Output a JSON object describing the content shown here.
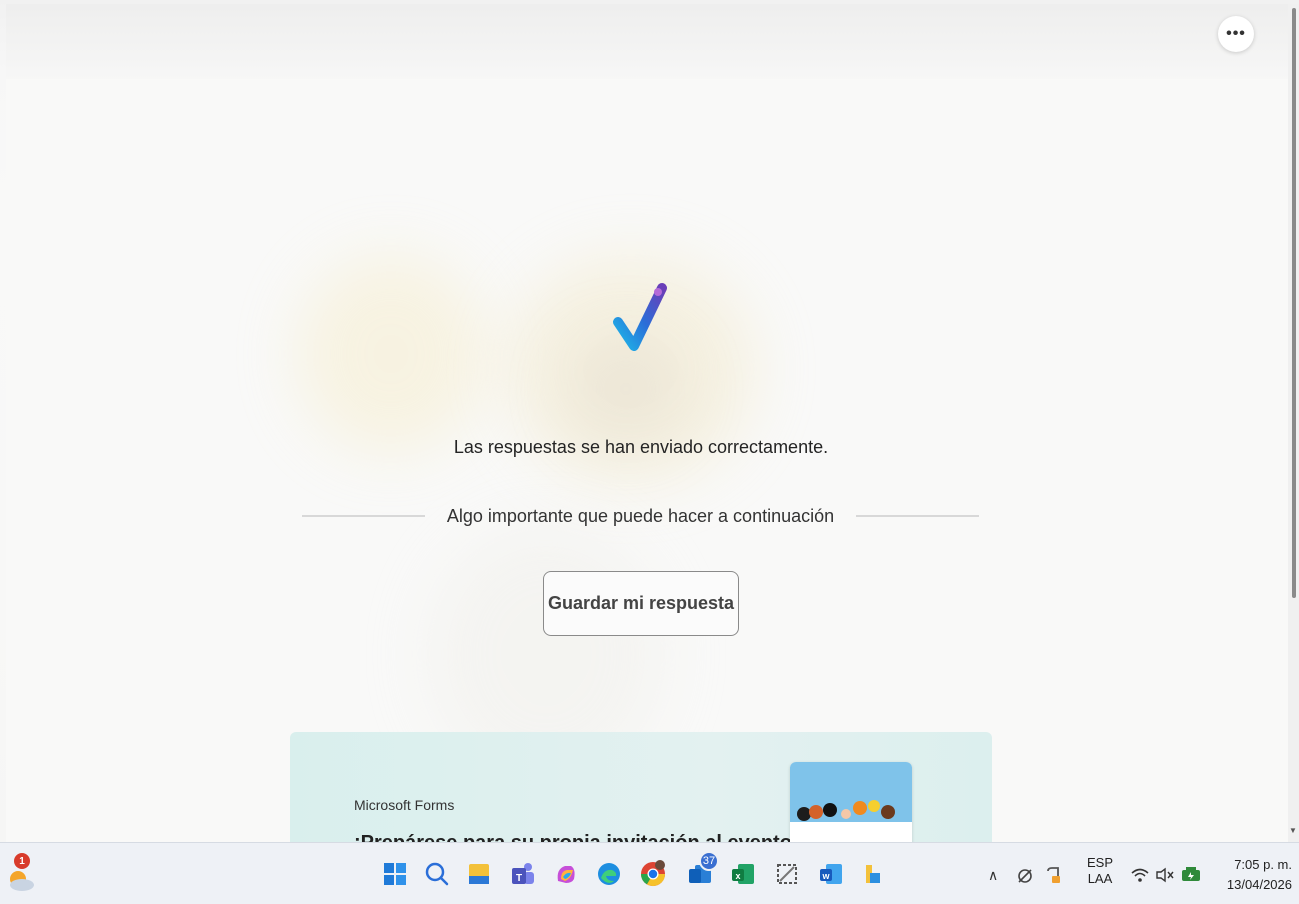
{
  "page": {
    "more_label": "•••",
    "confirmation": "Las respuestas se han enviado correctamente.",
    "next_step": "Algo importante que puede hacer a continuación",
    "save_button": "Guardar mi respuesta",
    "promo": {
      "brand": "Microsoft Forms",
      "title": "¡Prepárese para su propia invitación al evento!"
    }
  },
  "taskbar": {
    "weather_badge": "1",
    "apps": [
      {
        "name": "start",
        "icon": "windows-icon"
      },
      {
        "name": "search",
        "icon": "search-icon"
      },
      {
        "name": "file-explorer",
        "icon": "folder-icon"
      },
      {
        "name": "teams",
        "icon": "teams-icon"
      },
      {
        "name": "copilot",
        "icon": "copilot-icon"
      },
      {
        "name": "edge",
        "icon": "edge-icon"
      },
      {
        "name": "chrome",
        "icon": "chrome-icon"
      },
      {
        "name": "outlook",
        "icon": "outlook-icon",
        "badge": "37"
      },
      {
        "name": "excel",
        "icon": "excel-icon"
      },
      {
        "name": "snipping",
        "icon": "snipping-icon"
      },
      {
        "name": "word",
        "icon": "word-icon"
      },
      {
        "name": "app-extra",
        "icon": "app-icon"
      }
    ],
    "tray": {
      "lang_top": "ESP",
      "lang_bottom": "LAA",
      "time": "7:05 p. m.",
      "date": "13/04/2026"
    }
  },
  "colors": {
    "accent_blue": "#2b6fd6",
    "card_bg": "#ddf0ee",
    "badge_red": "#d83b2b"
  }
}
